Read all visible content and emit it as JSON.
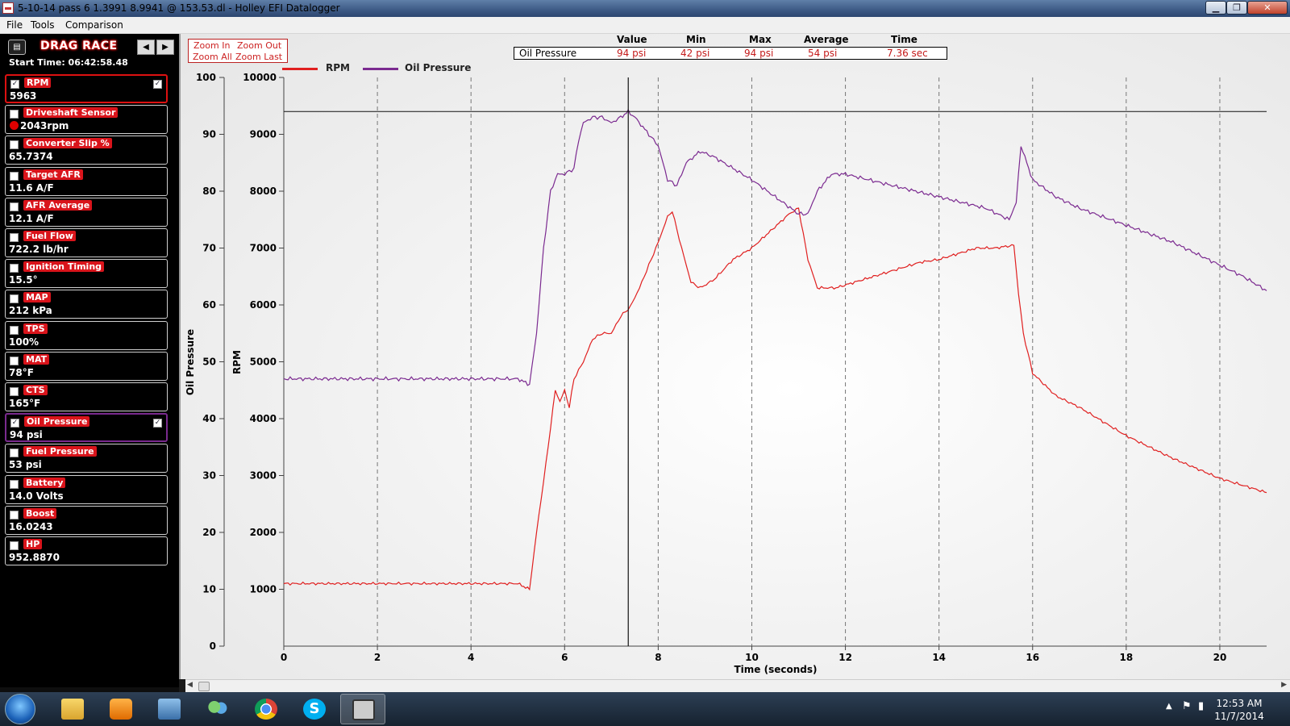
{
  "window": {
    "title": "5-10-14 pass 6 1.3991 8.9941 @ 153.53.dl - Holley EFI Datalogger",
    "min_glyph": "▁",
    "max_glyph": "❐",
    "close_glyph": "✕"
  },
  "menu": [
    "File",
    "Tools",
    "Comparison"
  ],
  "sidebar": {
    "title": "DRAG RACE",
    "start_time": "Start Time: 06:42:58.48",
    "menu_glyph": "▤",
    "prev_glyph": "◀",
    "next_glyph": "▶",
    "channels": [
      {
        "label": "RPM",
        "value": "5963",
        "checked": true
      },
      {
        "label": "Driveshaft Sensor",
        "value": "2043rpm",
        "checked": false
      },
      {
        "label": "Converter Slip %",
        "value": "65.7374",
        "checked": false
      },
      {
        "label": "Target AFR",
        "value": "11.6 A/F",
        "checked": false
      },
      {
        "label": "AFR Average",
        "value": "12.1 A/F",
        "checked": false
      },
      {
        "label": "Fuel Flow",
        "value": "722.2 lb/hr",
        "checked": false
      },
      {
        "label": "Ignition Timing",
        "value": "15.5°",
        "checked": false
      },
      {
        "label": "MAP",
        "value": "212 kPa",
        "checked": false
      },
      {
        "label": "TPS",
        "value": "100%",
        "checked": false
      },
      {
        "label": "MAT",
        "value": "78°F",
        "checked": false
      },
      {
        "label": "CTS",
        "value": "165°F",
        "checked": false
      },
      {
        "label": "Oil Pressure",
        "value": "94 psi",
        "checked": true
      },
      {
        "label": "Fuel Pressure",
        "value": "53 psi",
        "checked": false
      },
      {
        "label": "Battery",
        "value": "14.0 Volts",
        "checked": false
      },
      {
        "label": "Boost",
        "value": "16.0243",
        "checked": false
      },
      {
        "label": "HP",
        "value": "952.8870",
        "checked": false
      }
    ]
  },
  "zoom": {
    "zoom_in": "Zoom In",
    "zoom_out": "Zoom Out",
    "zoom_all": "Zoom All",
    "zoom_last": "Zoom Last"
  },
  "stats": {
    "headers": [
      "Value",
      "Min",
      "Max",
      "Average",
      "Time"
    ],
    "row": {
      "name": "Oil Pressure",
      "value": "94 psi",
      "min": "42 psi",
      "max": "94 psi",
      "average": "54 psi",
      "time": "7.36 sec"
    }
  },
  "colors": {
    "rpm": "#e02020",
    "oil": "#7b2a90",
    "stats_text": "#c41a1a"
  },
  "chart_data": {
    "type": "line",
    "xlabel": "Time (seconds)",
    "ylabel_left": "Oil Pressure",
    "ylabel_right": "RPM",
    "xlim": [
      0,
      21
    ],
    "xticks": [
      0,
      2,
      4,
      6,
      8,
      10,
      12,
      14,
      16,
      18,
      20
    ],
    "oil_ylim": [
      0,
      100
    ],
    "oil_yticks": [
      0,
      10,
      20,
      30,
      40,
      50,
      60,
      70,
      80,
      90,
      100
    ],
    "rpm_ylim": [
      0,
      10000
    ],
    "rpm_yticks": [
      1000,
      2000,
      3000,
      4000,
      5000,
      6000,
      7000,
      8000,
      9000,
      10000
    ],
    "grid_x": true,
    "cursor_x": 7.36,
    "cursor_y_oil": 94,
    "legend": "top-left",
    "series": [
      {
        "name": "RPM",
        "axis": "rpm",
        "x": [
          0,
          2,
          4,
          5,
          5.25,
          5.4,
          5.6,
          5.8,
          5.9,
          6.0,
          6.1,
          6.2,
          6.4,
          6.6,
          6.8,
          7.0,
          7.2,
          7.4,
          7.6,
          7.8,
          8.0,
          8.2,
          8.3,
          8.5,
          8.7,
          8.9,
          9.2,
          9.6,
          10.0,
          10.4,
          10.8,
          11.0,
          11.2,
          11.4,
          11.8,
          12.2,
          12.6,
          13.0,
          13.6,
          14.0,
          14.4,
          14.8,
          15.2,
          15.6,
          15.7,
          15.8,
          16.0,
          16.5,
          17.0,
          18.0,
          19.0,
          20.0,
          21.0
        ],
        "y": [
          1100,
          1100,
          1100,
          1100,
          1000,
          2000,
          3200,
          4500,
          4300,
          4500,
          4200,
          4700,
          5000,
          5400,
          5500,
          5500,
          5800,
          5963,
          6300,
          6700,
          7100,
          7550,
          7650,
          7000,
          6400,
          6300,
          6450,
          6800,
          7000,
          7300,
          7600,
          7700,
          6800,
          6300,
          6300,
          6400,
          6500,
          6600,
          6750,
          6800,
          6900,
          7000,
          7000,
          7050,
          6200,
          5500,
          4800,
          4400,
          4200,
          3700,
          3300,
          2950,
          2700
        ]
      },
      {
        "name": "Oil Pressure",
        "axis": "oil",
        "x": [
          0,
          2,
          4,
          5,
          5.25,
          5.4,
          5.55,
          5.7,
          5.85,
          6.0,
          6.2,
          6.3,
          6.4,
          6.6,
          6.8,
          7.0,
          7.2,
          7.36,
          7.5,
          7.8,
          8.0,
          8.2,
          8.4,
          8.6,
          8.9,
          9.2,
          9.6,
          10.0,
          10.5,
          11.0,
          11.2,
          11.4,
          11.7,
          12.0,
          12.5,
          13.0,
          13.5,
          14.0,
          14.5,
          15.0,
          15.5,
          15.65,
          15.75,
          16.0,
          16.5,
          17.0,
          18.0,
          19.0,
          20.0,
          20.5,
          21.0
        ],
        "y": [
          47,
          47,
          47,
          47,
          46,
          55,
          70,
          80,
          83,
          83,
          84,
          89,
          92,
          93,
          93,
          92,
          93,
          94,
          93,
          90,
          88,
          82,
          81,
          85,
          87,
          86,
          84,
          82,
          79,
          76,
          76,
          80,
          83,
          83,
          82,
          81,
          80,
          79,
          78,
          77,
          75,
          78,
          88,
          82,
          79,
          77,
          74,
          71,
          67,
          65,
          62.5
        ]
      }
    ]
  },
  "taskbar": {
    "clock_time": "12:53 AM",
    "clock_date": "11/7/2014"
  }
}
